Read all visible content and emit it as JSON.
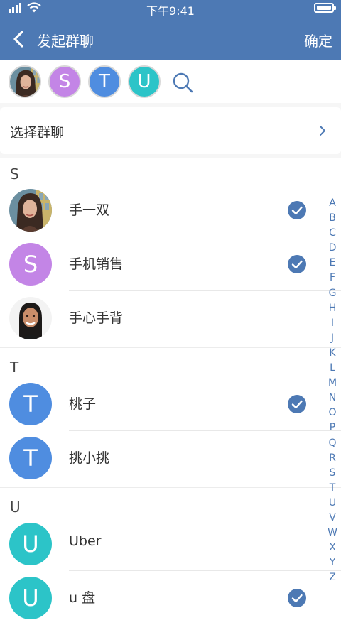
{
  "status_bar": {
    "time": "下午9:41"
  },
  "nav": {
    "title": "发起群聊",
    "confirm_label": "确定"
  },
  "selected_members": [
    {
      "type": "photo",
      "icon": "portrait-woman-long-hair"
    },
    {
      "type": "letter",
      "letter": "S",
      "color": "#c385e6"
    },
    {
      "type": "letter",
      "letter": "T",
      "color": "#4f8de0"
    },
    {
      "type": "letter",
      "letter": "U",
      "color": "#2cc4c8"
    }
  ],
  "group_select": {
    "label": "选择群聊"
  },
  "sections": [
    {
      "letter": "S",
      "contacts": [
        {
          "name": "手一双",
          "avatar": {
            "type": "photo",
            "icon": "portrait-woman-long-hair"
          },
          "checked": true
        },
        {
          "name": "手机销售",
          "avatar": {
            "type": "letter",
            "letter": "S",
            "color": "#c385e6"
          },
          "checked": true
        },
        {
          "name": "手心手背",
          "avatar": {
            "type": "photo",
            "icon": "portrait-woman-smiling"
          },
          "checked": false
        }
      ]
    },
    {
      "letter": "T",
      "contacts": [
        {
          "name": "桃子",
          "avatar": {
            "type": "letter",
            "letter": "T",
            "color": "#4f8de0"
          },
          "checked": true
        },
        {
          "name": "挑小挑",
          "avatar": {
            "type": "letter",
            "letter": "T",
            "color": "#4f8de0"
          },
          "checked": false
        }
      ]
    },
    {
      "letter": "U",
      "contacts": [
        {
          "name": "Uber",
          "avatar": {
            "type": "letter",
            "letter": "U",
            "color": "#2cc4c8"
          },
          "checked": false
        },
        {
          "name": "u 盘",
          "avatar": {
            "type": "letter",
            "letter": "U",
            "color": "#2cc4c8"
          },
          "checked": true
        }
      ]
    }
  ],
  "index_letters": [
    "A",
    "B",
    "C",
    "D",
    "E",
    "F",
    "G",
    "H",
    "I",
    "J",
    "K",
    "L",
    "M",
    "N",
    "O",
    "P",
    "Q",
    "R",
    "S",
    "T",
    "U",
    "V",
    "W",
    "X",
    "Y",
    "Z"
  ],
  "colors": {
    "accent": "#4d79b4",
    "check": "#4d79b4"
  }
}
